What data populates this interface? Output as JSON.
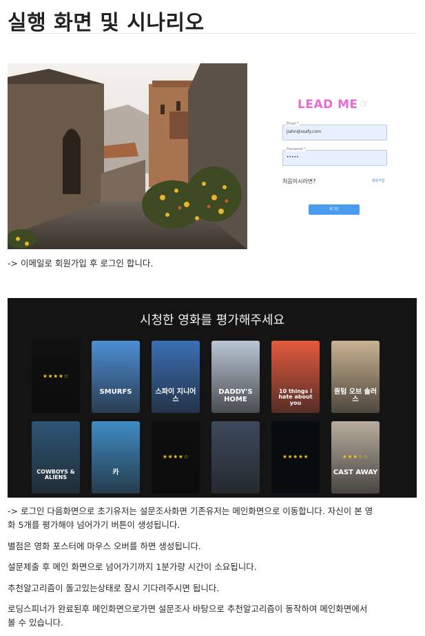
{
  "page": {
    "title": "실행 화면 및 시나리오"
  },
  "login": {
    "logo": "LEAD ME",
    "email_label": "Email *",
    "email_value": "jiahn@ssafy.com",
    "password_label": "Password *",
    "password_value": "•••••",
    "first_time": "처음이시라면?",
    "signup_link": "회원가입",
    "login_button": "로그인"
  },
  "captions": {
    "login": "-> 이메일로 회원가입 후 로그인 합니다."
  },
  "rating": {
    "title": "시청한 영화를 평가해주세요",
    "row1": [
      {
        "label": "",
        "color": "#2b2b2b",
        "stars": "★★★★☆",
        "dim": true
      },
      {
        "label": "SMURFS",
        "color": "#4d8ed6",
        "stars": "",
        "dim": false
      },
      {
        "label": "스파이 지니어스",
        "color": "#3b6fb6",
        "stars": "",
        "dim": false
      },
      {
        "label": "DADDY'S HOME",
        "color": "#b9c6d4",
        "stars": "",
        "dim": false
      },
      {
        "label": "10 things i hate about you",
        "color": "#e45a3e",
        "stars": "",
        "dim": false
      },
      {
        "label": "퀀텀 오브 솔러스",
        "color": "#c8b392",
        "stars": "",
        "dim": false
      }
    ],
    "row2": [
      {
        "label": "COWBOYS & ALIENS",
        "color": "#2d5576",
        "stars": "",
        "dim": false
      },
      {
        "label": "카",
        "color": "#3f8cc6",
        "stars": "",
        "dim": false
      },
      {
        "label": "",
        "color": "#2a2626",
        "stars": "★★★★☆",
        "dim": true
      },
      {
        "label": "",
        "color": "#3d4a5c",
        "stars": "",
        "dim": false
      },
      {
        "label": "",
        "color": "#10202b",
        "stars": "★★★★★",
        "dim": true
      },
      {
        "label": "CAST AWAY",
        "color": "#b8ad9e",
        "stars": "★★★☆☆",
        "dim": false
      }
    ]
  },
  "paragraphs": {
    "p1_line1": "-> 로그인 다음화면으로 초기유저는 설문조사화면 기존유저는 메인화면으로 이동합니다. 자신이 본 영",
    "p1_line2": "화 5개를 평가해야 넘어가기 버튼이 생성됩니다.",
    "p2": "별점은 영화 포스터에 마우스 오버를 하면 생성됩니다.",
    "p3": "설문제출 후 메인 화면으로 넘어가기까지 1분가량 시간이 소요됩니다.",
    "p4": "추천알고리즘이 돌고있는상태로 잠시 기다려주시면 됩니다.",
    "p5_line1": "로딩스피너가 완료된후 메인화면으로가면 설문조사 바탕으로 추천알고리즘이 동작하여 메인화면에서",
    "p5_line2": "볼 수 있습니다."
  }
}
